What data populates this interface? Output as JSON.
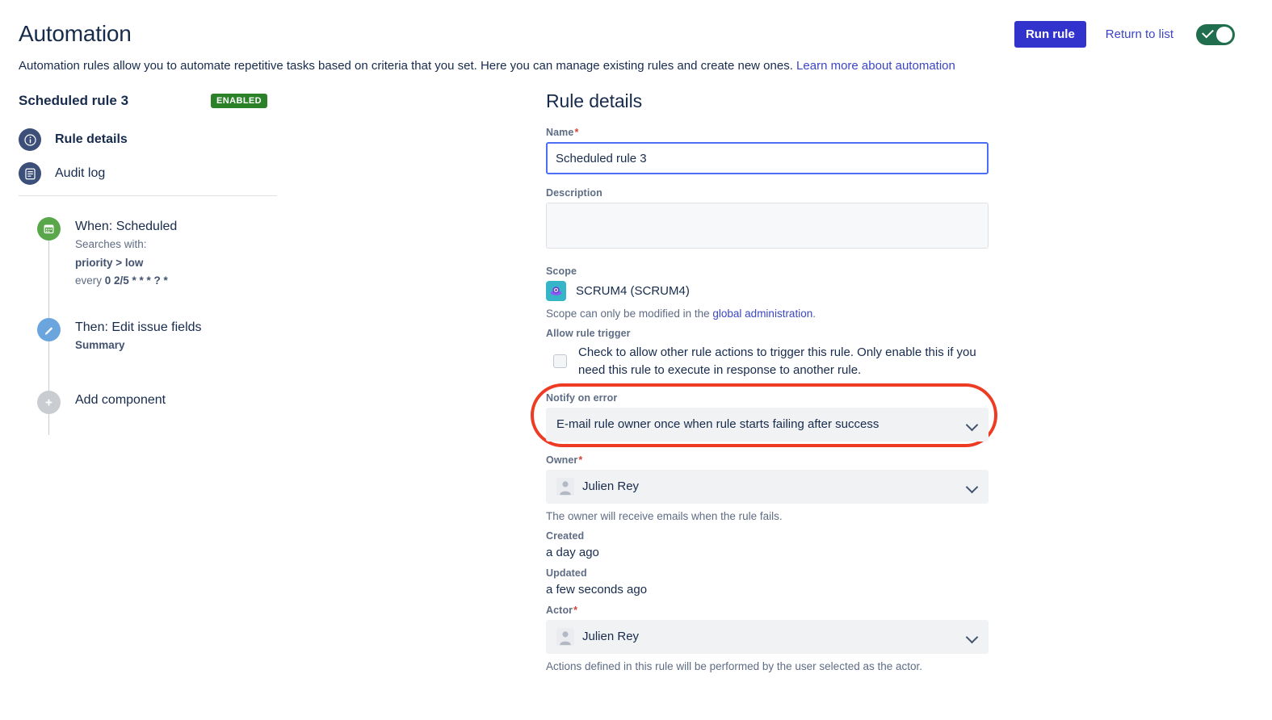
{
  "header": {
    "title": "Automation",
    "subtitle_text": "Automation rules allow you to automate repetitive tasks based on criteria that you set. Here you can manage existing rules and create new ones. ",
    "learn_more_link": "Learn more about automation",
    "run_rule_label": "Run rule",
    "return_to_list_label": "Return to list",
    "toggle_state": "on"
  },
  "colors": {
    "primary_button": "#3232cc",
    "link": "#3b46c4",
    "enabled_badge": "#2a8127",
    "toggle_on": "#216e4e",
    "highlight_ring": "#ee3b24",
    "trigger_dot": "#5aa64b",
    "action_dot": "#6ba5dd",
    "add_dot": "#c9ccd1",
    "nav_icon": "#3b4f79"
  },
  "sidebar": {
    "rule_name": "Scheduled rule 3",
    "status_badge": "ENABLED",
    "nav_items": [
      {
        "label": "Rule details",
        "icon": "info-circle-icon",
        "active": true
      },
      {
        "label": "Audit log",
        "icon": "list-document-icon",
        "active": false
      }
    ],
    "flow": [
      {
        "title": "When: Scheduled",
        "icon": "calendar-icon",
        "sub_label": "Searches with:",
        "sub_line1": "priority > low",
        "sub_line2_prefix": "every ",
        "sub_line2_value": "0 2/5 * * * ? *"
      },
      {
        "title": "Then: Edit issue fields",
        "icon": "pencil-icon",
        "sub_label": "Summary"
      },
      {
        "title": "Add component",
        "icon": "plus-icon"
      }
    ]
  },
  "main": {
    "title": "Rule details",
    "name": {
      "label": "Name",
      "required": "*",
      "value": "Scheduled rule 3"
    },
    "description": {
      "label": "Description",
      "value": "",
      "placeholder": ""
    },
    "scope": {
      "label": "Scope",
      "project": "SCRUM4 (SCRUM4)",
      "help_prefix": "Scope can only be modified in the ",
      "help_link": "global administration",
      "help_suffix": "."
    },
    "allow_rule_trigger": {
      "label": "Allow rule trigger",
      "checked": false,
      "text": "Check to allow other rule actions to trigger this rule. Only enable this if you need this rule to execute in response to another rule."
    },
    "notify_on_error": {
      "label": "Notify on error",
      "value": "E-mail rule owner once when rule starts failing after success",
      "highlighted": true
    },
    "owner": {
      "label": "Owner",
      "required": "*",
      "value": "Julien Rey",
      "help": "The owner will receive emails when the rule fails."
    },
    "created": {
      "label": "Created",
      "value": "a day ago"
    },
    "updated": {
      "label": "Updated",
      "value": "a few seconds ago"
    },
    "actor": {
      "label": "Actor",
      "required": "*",
      "value": "Julien Rey",
      "help": "Actions defined in this rule will be performed by the user selected as the actor."
    }
  }
}
